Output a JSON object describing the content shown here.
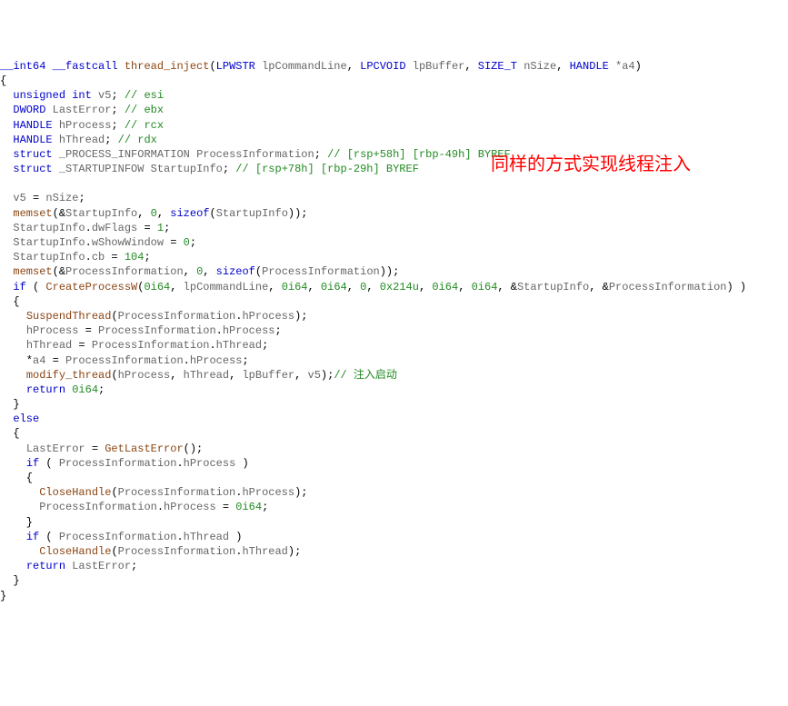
{
  "annotation": "同样的方式实现线程注入",
  "code": {
    "sig_ret": "__int64",
    "sig_cc": "__fastcall",
    "sig_name": "thread_inject",
    "sig_p1t": "LPWSTR",
    "sig_p1n": "lpCommandLine",
    "sig_p2t": "LPCVOID",
    "sig_p2n": "lpBuffer",
    "sig_p3t": "SIZE_T",
    "sig_p3n": "nSize",
    "sig_p4t": "HANDLE",
    "sig_p4n": "*a4",
    "d1t": "unsigned int",
    "d1n": "v5",
    "d1c": "// esi",
    "d2t": "DWORD",
    "d2n": "LastError",
    "d2c": "// ebx",
    "d3t": "HANDLE",
    "d3n": "hProcess",
    "d3c": "// rcx",
    "d4t": "HANDLE",
    "d4n": "hThread",
    "d4c": "// rdx",
    "d5k": "struct",
    "d5t": "_PROCESS_INFORMATION",
    "d5n": "ProcessInformation",
    "d5c": "// [rsp+58h] [rbp-49h] BYREF",
    "d6k": "struct",
    "d6t": "_STARTUPINFOW",
    "d6n": "StartupInfo",
    "d6c": "// [rsp+78h] [rbp-29h] BYREF",
    "l1_v5": "v5",
    "l1_nSize": "nSize",
    "l2_memset": "memset",
    "l2_si": "StartupInfo",
    "l2_0": "0",
    "l2_sizeof": "sizeof",
    "l2_si2": "StartupInfo",
    "l3_si": "StartupInfo",
    "l3_f": "dwFlags",
    "l3_v": "1",
    "l4_si": "StartupInfo",
    "l4_f": "wShowWindow",
    "l4_v": "0",
    "l5_si": "StartupInfo",
    "l5_f": "cb",
    "l5_v": "104",
    "l6_memset": "memset",
    "l6_pi": "ProcessInformation",
    "l6_0": "0",
    "l6_sizeof": "sizeof",
    "l6_pi2": "ProcessInformation",
    "l7_if": "if",
    "l7_cpw": "CreateProcessW",
    "l7_a1": "0i64",
    "l7_a2": "lpCommandLine",
    "l7_a3": "0i64",
    "l7_a4": "0i64",
    "l7_a5": "0",
    "l7_a6": "0x214u",
    "l7_a7": "0i64",
    "l7_a8": "0i64",
    "l7_a9": "StartupInfo",
    "l7_a10": "ProcessInformation",
    "l8_st": "SuspendThread",
    "l8_pi": "ProcessInformation",
    "l8_f": "hProcess",
    "l9_hp": "hProcess",
    "l9_pi": "ProcessInformation",
    "l9_f": "hProcess",
    "l10_ht": "hThread",
    "l10_pi": "ProcessInformation",
    "l10_f": "hThread",
    "l11_a4": "a4",
    "l11_pi": "ProcessInformation",
    "l11_f": "hProcess",
    "l12_mt": "modify_thread",
    "l12_a1": "hProcess",
    "l12_a2": "hThread",
    "l12_a3": "lpBuffer",
    "l12_a4": "v5",
    "l12_c": "// 注入启动",
    "l13_ret": "return",
    "l13_v": "0i64",
    "l14_else": "else",
    "l15_le": "LastError",
    "l15_gle": "GetLastError",
    "l16_if": "if",
    "l16_pi": "ProcessInformation",
    "l16_f": "hProcess",
    "l17_ch": "CloseHandle",
    "l17_pi": "ProcessInformation",
    "l17_f": "hProcess",
    "l18_pi": "ProcessInformation",
    "l18_f": "hProcess",
    "l18_v": "0i64",
    "l19_if": "if",
    "l19_pi": "ProcessInformation",
    "l19_f": "hThread",
    "l20_ch": "CloseHandle",
    "l20_pi": "ProcessInformation",
    "l20_f": "hThread",
    "l21_ret": "return",
    "l21_v": "LastError"
  }
}
